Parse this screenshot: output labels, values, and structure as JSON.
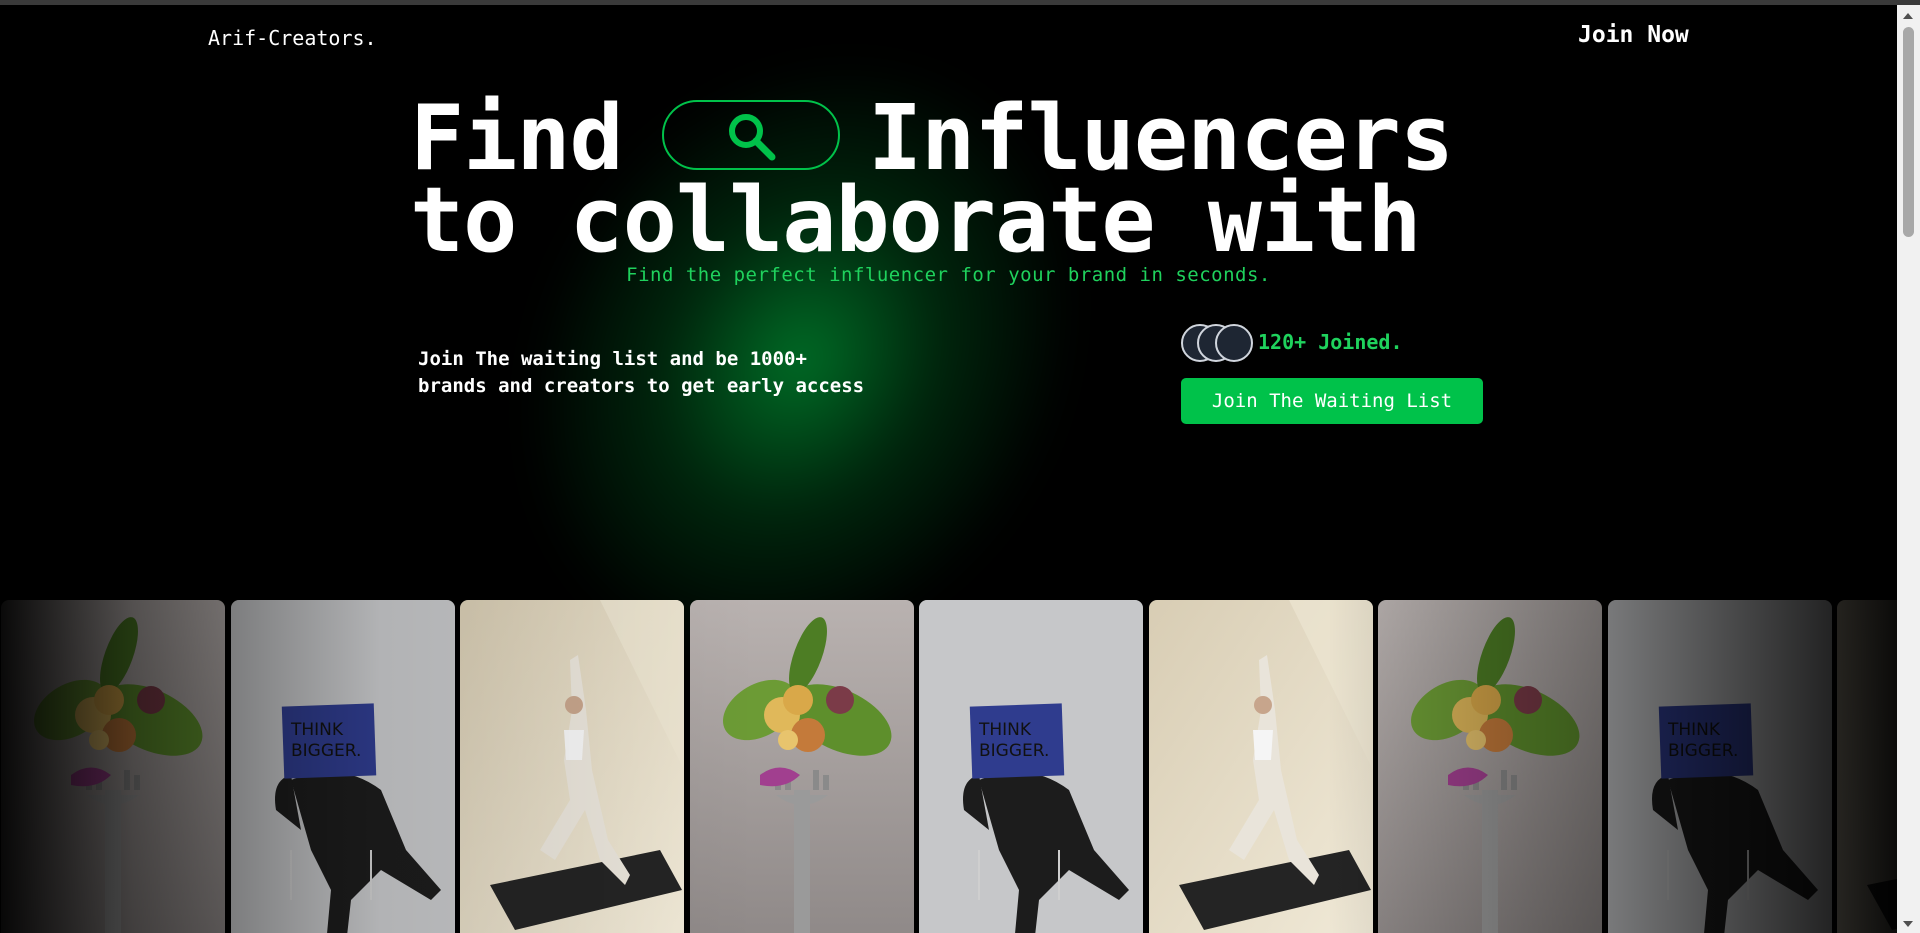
{
  "header": {
    "brand": "Arif-Creators.",
    "join_now": "Join Now"
  },
  "hero": {
    "line1_word1": "Find",
    "line1_word2": "Influencers",
    "line2": "to collaborate with",
    "subtitle": "Find the perfect influencer for your brand in seconds.",
    "search_icon": "search-icon"
  },
  "waitlist": {
    "line1": "Join The waiting list and be 1000+",
    "line2": "brands and creators to get early access",
    "joined": "120+ Joined.",
    "button": "Join The Waiting List"
  },
  "gallery": {
    "cards": [
      {
        "kind": "salad"
      },
      {
        "kind": "think",
        "sign_line1": "THINK",
        "sign_line2": "BIGGER."
      },
      {
        "kind": "yoga"
      },
      {
        "kind": "salad"
      },
      {
        "kind": "think",
        "sign_line1": "THINK",
        "sign_line2": "BIGGER."
      },
      {
        "kind": "yoga"
      },
      {
        "kind": "salad"
      },
      {
        "kind": "think",
        "sign_line1": "THINK",
        "sign_line2": "BIGGER."
      },
      {
        "kind": "yoga"
      }
    ]
  },
  "colors": {
    "accent": "#00c24a",
    "accent_text": "#1fd25d",
    "background": "#000000"
  }
}
